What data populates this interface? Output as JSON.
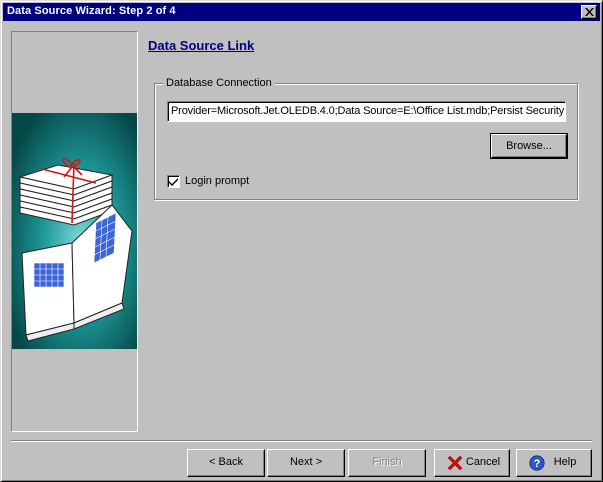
{
  "window": {
    "title": "Data Source Wizard: Step 2 of 4"
  },
  "page": {
    "heading": "Data Source Link"
  },
  "database_connection": {
    "group_label": "Database Connection",
    "connection_string": "Provider=Microsoft.Jet.OLEDB.4.0;Data Source=E:\\Office List.mdb;Persist Security",
    "browse_label": "Browse...",
    "login_prompt_label": "Login prompt",
    "login_prompt_checked": true
  },
  "footer": {
    "back_prefix": "< ",
    "back_label": "Back",
    "next_label": "Next >",
    "finish_label": "Finish",
    "cancel_label": "Cancel",
    "help_label": "Help"
  },
  "icons": {
    "close": "close-icon",
    "cancel": "red-x-icon",
    "help": "help-question-icon",
    "checkbox": "checkmark-icon"
  },
  "colors": {
    "titlebar": "#000080",
    "heading": "#000080",
    "panel_bg": "#c0c0c0",
    "illustration_bg": "#0f6a6a"
  }
}
